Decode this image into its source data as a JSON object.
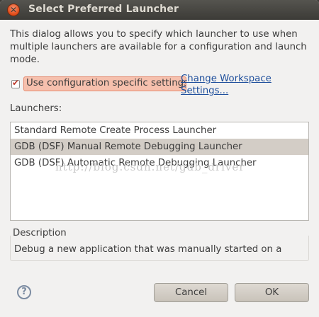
{
  "window": {
    "title": "Select Preferred Launcher",
    "close_glyph": "✕"
  },
  "intro_text": "This dialog allows you to specify which launcher to use when multiple launchers are available for a configuration and launch mode.",
  "config_specific": {
    "checked": true,
    "label": "Use configuration specific settings"
  },
  "workspace_link": {
    "line1": "Change Workspace",
    "line2": "Settings..."
  },
  "launchers": {
    "label": "Launchers:",
    "items": [
      {
        "label": "Standard Remote Create Process Launcher",
        "selected": false
      },
      {
        "label": "GDB (DSF) Manual Remote Debugging Launcher",
        "selected": true
      },
      {
        "label": "GDB (DSF) Automatic Remote Debugging Launcher",
        "selected": false
      }
    ]
  },
  "watermark": "http://blog.csdn.net/gdb_driver",
  "description": {
    "label": "Description",
    "text": "Debug a new application that was manually started on a"
  },
  "buttons": {
    "help": "?",
    "cancel": "Cancel",
    "ok": "OK"
  },
  "colors": {
    "titlebar": "#3c3b37",
    "close_button": "#df4a16",
    "link": "#1f4f9c",
    "selection": "#d3cdc6",
    "checkbox_highlight": "#f6c0ad"
  }
}
